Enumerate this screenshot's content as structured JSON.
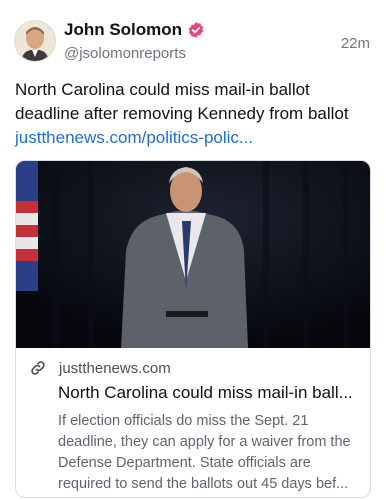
{
  "author": {
    "display_name": "John Solomon",
    "handle": "@jsolomonreports",
    "verified_color": "#e8457c"
  },
  "post": {
    "time": "22m",
    "text": "North Carolina could miss mail-in ballot deadline after removing Kennedy from ballot",
    "link": "justthenews.com/politics-polic..."
  },
  "card": {
    "domain": "justthenews.com",
    "title": "North Carolina could miss mail-in ball...",
    "description": "If election officials do miss the Sept. 21 deadline, they can apply for a waiver from the Defense Department. State officials are required to send the ballots out 45 days bef..."
  },
  "icons": {
    "verified": "verified-badge-icon",
    "link": "link-icon"
  }
}
